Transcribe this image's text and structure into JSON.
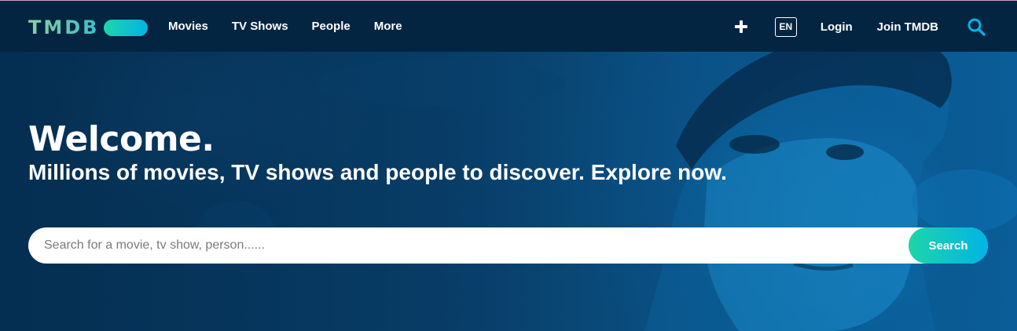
{
  "brand": {
    "logo_text": "TMDB",
    "colors": {
      "green": "#90cea1",
      "teal": "#1ed5a9",
      "blue": "#01b4e4",
      "navy": "#032541"
    }
  },
  "nav": {
    "items": [
      {
        "label": "Movies"
      },
      {
        "label": "TV Shows"
      },
      {
        "label": "People"
      },
      {
        "label": "More"
      }
    ],
    "add_icon": "plus-icon",
    "language": "EN",
    "login": "Login",
    "join": "Join TMDB",
    "search_icon": "search-icon"
  },
  "hero": {
    "title": "Welcome.",
    "subtitle": "Millions of movies, TV shows and people to discover. Explore now.",
    "search": {
      "placeholder": "Search for a movie, tv show, person......",
      "value": "",
      "button_label": "Search"
    }
  }
}
